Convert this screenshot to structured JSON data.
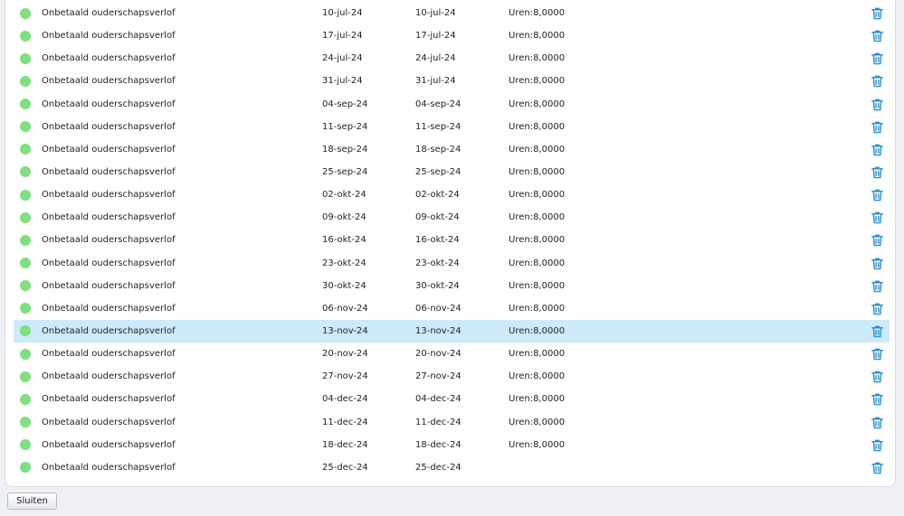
{
  "colors": {
    "status_dot": "#7ee07e",
    "selected_row": "#cdeafa",
    "trash_icon": "#2a8fce"
  },
  "icons": {
    "status": "status-dot-icon",
    "delete": "trash-icon"
  },
  "rows": [
    {
      "type": "Onbetaald ouderschapsverlof",
      "start": "10-jul-24",
      "end": "10-jul-24",
      "hours": "Uren:8,0000"
    },
    {
      "type": "Onbetaald ouderschapsverlof",
      "start": "17-jul-24",
      "end": "17-jul-24",
      "hours": "Uren:8,0000"
    },
    {
      "type": "Onbetaald ouderschapsverlof",
      "start": "24-jul-24",
      "end": "24-jul-24",
      "hours": "Uren:8,0000"
    },
    {
      "type": "Onbetaald ouderschapsverlof",
      "start": "31-jul-24",
      "end": "31-jul-24",
      "hours": "Uren:8,0000"
    },
    {
      "type": "Onbetaald ouderschapsverlof",
      "start": "04-sep-24",
      "end": "04-sep-24",
      "hours": "Uren:8,0000"
    },
    {
      "type": "Onbetaald ouderschapsverlof",
      "start": "11-sep-24",
      "end": "11-sep-24",
      "hours": "Uren:8,0000"
    },
    {
      "type": "Onbetaald ouderschapsverlof",
      "start": "18-sep-24",
      "end": "18-sep-24",
      "hours": "Uren:8,0000"
    },
    {
      "type": "Onbetaald ouderschapsverlof",
      "start": "25-sep-24",
      "end": "25-sep-24",
      "hours": "Uren:8,0000"
    },
    {
      "type": "Onbetaald ouderschapsverlof",
      "start": "02-okt-24",
      "end": "02-okt-24",
      "hours": "Uren:8,0000"
    },
    {
      "type": "Onbetaald ouderschapsverlof",
      "start": "09-okt-24",
      "end": "09-okt-24",
      "hours": "Uren:8,0000"
    },
    {
      "type": "Onbetaald ouderschapsverlof",
      "start": "16-okt-24",
      "end": "16-okt-24",
      "hours": "Uren:8,0000"
    },
    {
      "type": "Onbetaald ouderschapsverlof",
      "start": "23-okt-24",
      "end": "23-okt-24",
      "hours": "Uren:8,0000"
    },
    {
      "type": "Onbetaald ouderschapsverlof",
      "start": "30-okt-24",
      "end": "30-okt-24",
      "hours": "Uren:8,0000"
    },
    {
      "type": "Onbetaald ouderschapsverlof",
      "start": "06-nov-24",
      "end": "06-nov-24",
      "hours": "Uren:8,0000"
    },
    {
      "type": "Onbetaald ouderschapsverlof",
      "start": "13-nov-24",
      "end": "13-nov-24",
      "hours": "Uren:8,0000",
      "selected": true
    },
    {
      "type": "Onbetaald ouderschapsverlof",
      "start": "20-nov-24",
      "end": "20-nov-24",
      "hours": "Uren:8,0000"
    },
    {
      "type": "Onbetaald ouderschapsverlof",
      "start": "27-nov-24",
      "end": "27-nov-24",
      "hours": "Uren:8,0000"
    },
    {
      "type": "Onbetaald ouderschapsverlof",
      "start": "04-dec-24",
      "end": "04-dec-24",
      "hours": "Uren:8,0000"
    },
    {
      "type": "Onbetaald ouderschapsverlof",
      "start": "11-dec-24",
      "end": "11-dec-24",
      "hours": "Uren:8,0000"
    },
    {
      "type": "Onbetaald ouderschapsverlof",
      "start": "18-dec-24",
      "end": "18-dec-24",
      "hours": "Uren:8,0000"
    },
    {
      "type": "Onbetaald ouderschapsverlof",
      "start": "25-dec-24",
      "end": "25-dec-24",
      "hours": ""
    }
  ],
  "footer": {
    "close_label": "Sluiten"
  }
}
